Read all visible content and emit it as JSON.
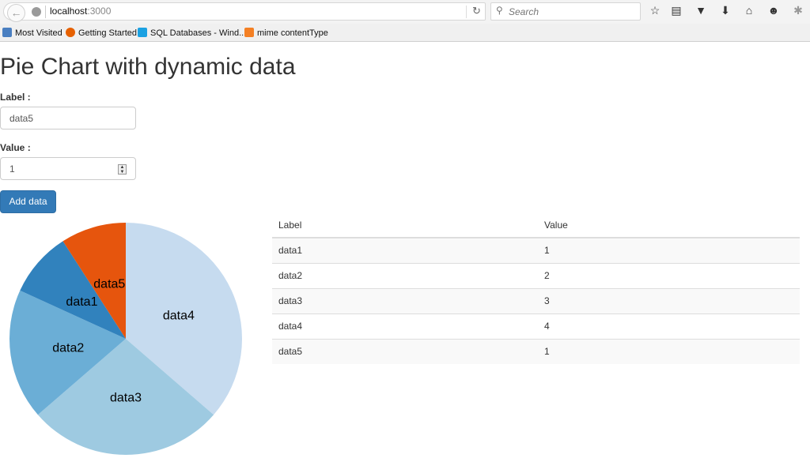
{
  "browser": {
    "url_host": "localhost",
    "url_port": ":3000",
    "search_placeholder": "Search",
    "bookmarks": [
      "Most Visited",
      "Getting Started",
      "SQL Databases - Wind...",
      "mime contentType"
    ]
  },
  "page": {
    "title": "Pie Chart with dynamic data",
    "label_field_label": "Label :",
    "label_field_value": "data5",
    "value_field_label": "Value :",
    "value_field_value": "1",
    "add_button": "Add data"
  },
  "table": {
    "headers": [
      "Label",
      "Value"
    ],
    "rows": [
      [
        "data1",
        "1"
      ],
      [
        "data2",
        "2"
      ],
      [
        "data3",
        "3"
      ],
      [
        "data4",
        "4"
      ],
      [
        "data5",
        "1"
      ]
    ]
  },
  "chart_data": {
    "type": "pie",
    "title": "",
    "categories": [
      "data1",
      "data2",
      "data3",
      "data4",
      "data5"
    ],
    "values": [
      1,
      2,
      3,
      4,
      1
    ],
    "colors": [
      "#3182bd",
      "#6baed6",
      "#9ecae1",
      "#c6dbef",
      "#e6550d"
    ],
    "slice_order_clockwise_from_top": [
      "data4",
      "data3",
      "data2",
      "data1",
      "data5"
    ],
    "legend": "none"
  }
}
